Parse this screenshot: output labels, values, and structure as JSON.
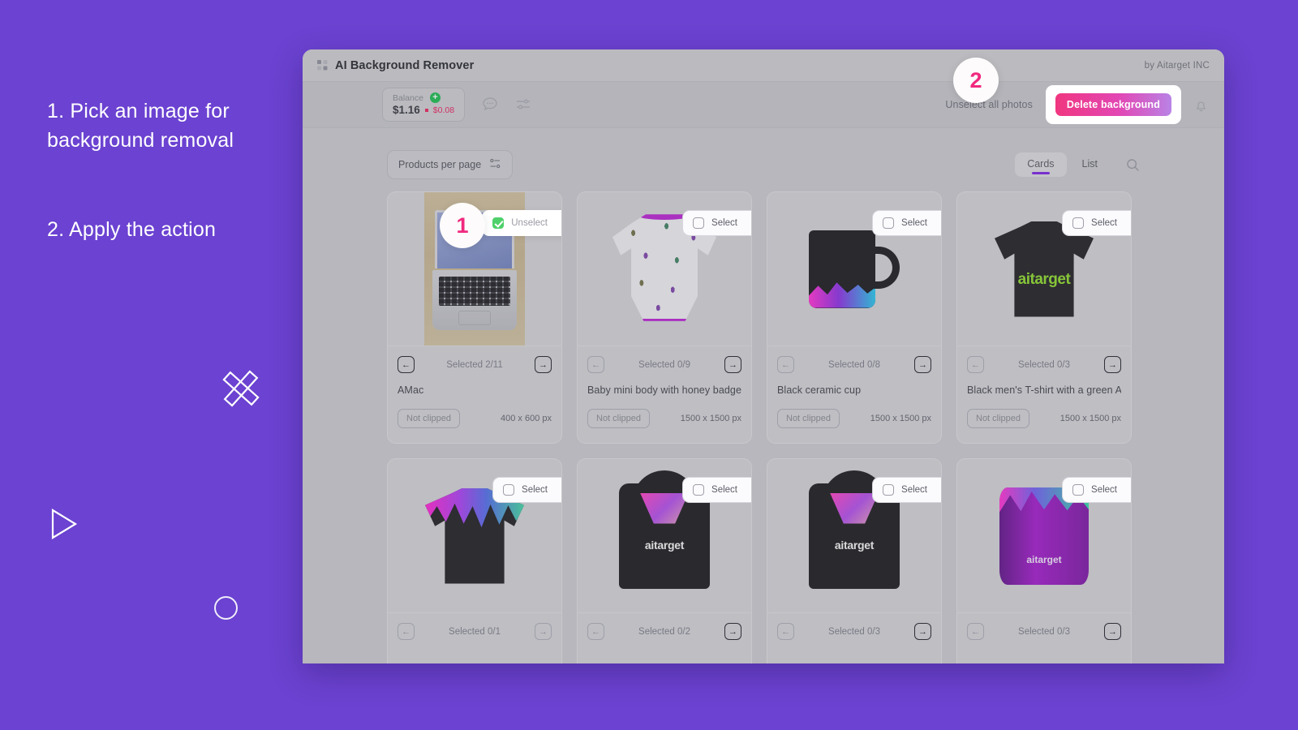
{
  "instructions": {
    "step1": "1. Pick an image for background removal",
    "step2": "2. Apply the action"
  },
  "callouts": {
    "one": "1",
    "two": "2"
  },
  "window": {
    "title": "AI Background Remover",
    "byline": "by Aitarget INC",
    "grid_icon": "grid-icon"
  },
  "toolbar": {
    "balance_label": "Balance",
    "balance_amount": "$1.16",
    "balance_delta": "$0.08",
    "plus_label": "+",
    "chat_icon": "chat-bubble-icon",
    "settings_icon": "sliders-icon",
    "unselect_all_label": "Unselect all photos",
    "delete_background_label": "Delete background",
    "bell_icon": "bell-icon",
    "accent_gradient_from": "#f0367f",
    "accent_gradient_to": "#b983e6"
  },
  "content_bar": {
    "per_page_label": "Products per page",
    "per_page_icon": "sliders-icon",
    "tabs": [
      {
        "label": "Cards",
        "active": true
      },
      {
        "label": "List",
        "active": false
      }
    ],
    "search_icon": "search-icon",
    "active_tab_color": "#7a1fe0"
  },
  "cards": [
    {
      "select_label": "Unselect",
      "checked": true,
      "selected_count": "Selected 2/11",
      "title": "AMac",
      "clip_status": "Not clipped",
      "dimensions": "400 x 600 px",
      "prev_enabled": true,
      "next_enabled": true,
      "art": "laptop"
    },
    {
      "select_label": "Select",
      "checked": false,
      "selected_count": "Selected 0/9",
      "title": "Baby mini body with honey badgers",
      "clip_status": "Not clipped",
      "dimensions": "1500 x 1500 px",
      "prev_enabled": false,
      "next_enabled": true,
      "art": "onesie"
    },
    {
      "select_label": "Select",
      "checked": false,
      "selected_count": "Selected 0/8",
      "title": "Black ceramic cup",
      "clip_status": "Not clipped",
      "dimensions": "1500 x 1500 px",
      "prev_enabled": false,
      "next_enabled": true,
      "art": "mug"
    },
    {
      "select_label": "Select",
      "checked": false,
      "selected_count": "Selected 0/3",
      "title": "Black men's T-shirt with a green Aitarget logo",
      "clip_status": "Not clipped",
      "dimensions": "1500 x 1500 px",
      "prev_enabled": false,
      "next_enabled": true,
      "art": "tshirt-logo"
    },
    {
      "select_label": "Select",
      "checked": false,
      "selected_count": "Selected 0/1",
      "title": "",
      "clip_status": "",
      "dimensions": "",
      "prev_enabled": false,
      "next_enabled": false,
      "art": "tshirt-drip"
    },
    {
      "select_label": "Select",
      "checked": false,
      "selected_count": "Selected 0/2",
      "title": "",
      "clip_status": "",
      "dimensions": "",
      "prev_enabled": false,
      "next_enabled": true,
      "art": "hoodie-open"
    },
    {
      "select_label": "Select",
      "checked": false,
      "selected_count": "Selected 0/3",
      "title": "",
      "clip_status": "",
      "dimensions": "",
      "prev_enabled": false,
      "next_enabled": true,
      "art": "hoodie-logo"
    },
    {
      "select_label": "Select",
      "checked": false,
      "selected_count": "Selected 0/3",
      "title": "",
      "clip_status": "",
      "dimensions": "",
      "prev_enabled": false,
      "next_enabled": true,
      "art": "cylinder"
    }
  ],
  "card_arrows": {
    "prev": "←",
    "next": "→"
  },
  "brand_text": {
    "aitarget": "aitarget"
  },
  "background_color": "#6b42d1"
}
